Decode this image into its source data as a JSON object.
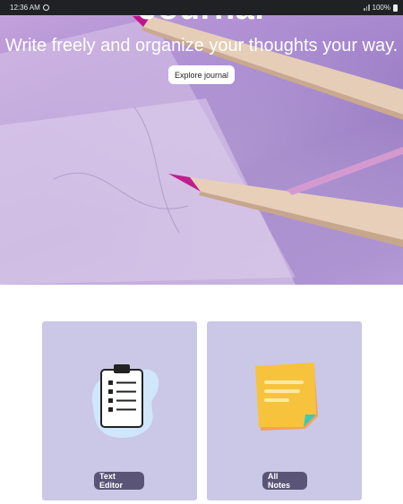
{
  "status_bar": {
    "time": "12:36 AM",
    "battery": "100%"
  },
  "hero": {
    "title": "Journal",
    "subtitle": "Write freely and organize your thoughts your way.",
    "button_label": "Explore journal"
  },
  "cards": [
    {
      "label": "Text Editor",
      "icon": "clipboard-checklist-icon"
    },
    {
      "label": "All Notes",
      "icon": "sticky-note-icon"
    }
  ],
  "colors": {
    "hero_purple": "#a98ad0",
    "card_background": "#cbc7e7",
    "label_background": "#5a5576"
  }
}
